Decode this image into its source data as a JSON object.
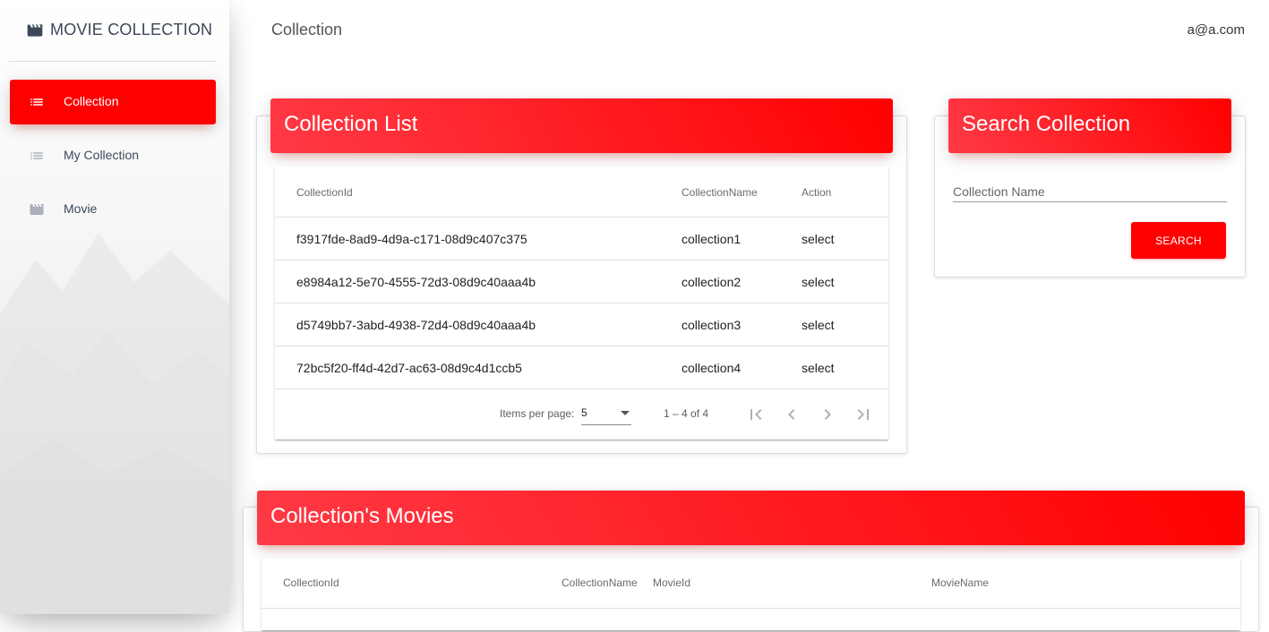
{
  "app": {
    "brand": "MOVIE COLLECTION",
    "brand_icon": "clapperboard-icon",
    "accent_color": "#ff0000"
  },
  "sidebar": {
    "items": [
      {
        "label": "Collection",
        "icon": "list-icon",
        "active": true
      },
      {
        "label": "My Collection",
        "icon": "list-icon",
        "active": false
      },
      {
        "label": "Movie",
        "icon": "clapperboard-icon",
        "active": false
      }
    ]
  },
  "topbar": {
    "title": "Collection",
    "user": "a@a.com"
  },
  "collection_list": {
    "title": "Collection List",
    "columns": [
      "CollectionId",
      "CollectionName",
      "Action"
    ],
    "rows": [
      {
        "id": "f3917fde-8ad9-4d9a-c171-08d9c407c375",
        "name": "collection1",
        "action": "select"
      },
      {
        "id": "e8984a12-5e70-4555-72d3-08d9c40aaa4b",
        "name": "collection2",
        "action": "select"
      },
      {
        "id": "d5749bb7-3abd-4938-72d4-08d9c40aaa4b",
        "name": "collection3",
        "action": "select"
      },
      {
        "id": "72bc5f20-ff4d-42d7-ac63-08d9c4d1ccb5",
        "name": "collection4",
        "action": "select"
      }
    ],
    "paginator": {
      "items_per_page_label": "Items per page:",
      "items_per_page": "5",
      "range": "1 – 4 of 4"
    }
  },
  "search_collection": {
    "title": "Search Collection",
    "input_placeholder": "Collection Name",
    "input_value": "",
    "button_label": "SEARCH"
  },
  "collection_movies": {
    "title": "Collection's Movies",
    "columns": [
      "CollectionId",
      "CollectionName",
      "MovieId",
      "MovieName"
    ]
  }
}
